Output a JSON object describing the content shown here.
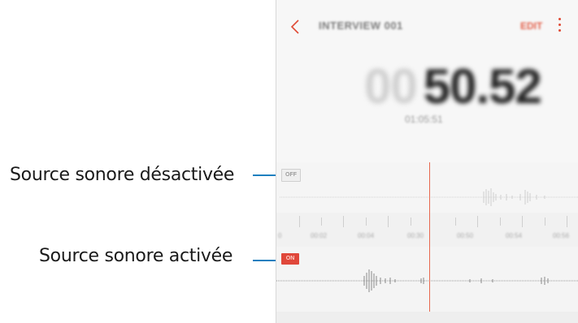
{
  "callouts": {
    "muted_label": "Source sonore désactivée",
    "active_label": "Source sonore activée"
  },
  "app": {
    "title": "INTERVIEW 001",
    "edit_label": "EDIT",
    "timer_minutes": "00",
    "timer_seconds": "50.52",
    "sub_time": "01:05:51"
  },
  "tracks": {
    "muted_badge": "OFF",
    "active_badge": "ON"
  },
  "timeline": {
    "labels": [
      "0",
      "00:02",
      "00:04",
      "00:30",
      "00:50",
      "00:54",
      "00:56"
    ]
  },
  "colors": {
    "accent": "#e04b36",
    "callout_line": "#1e7fbf"
  }
}
